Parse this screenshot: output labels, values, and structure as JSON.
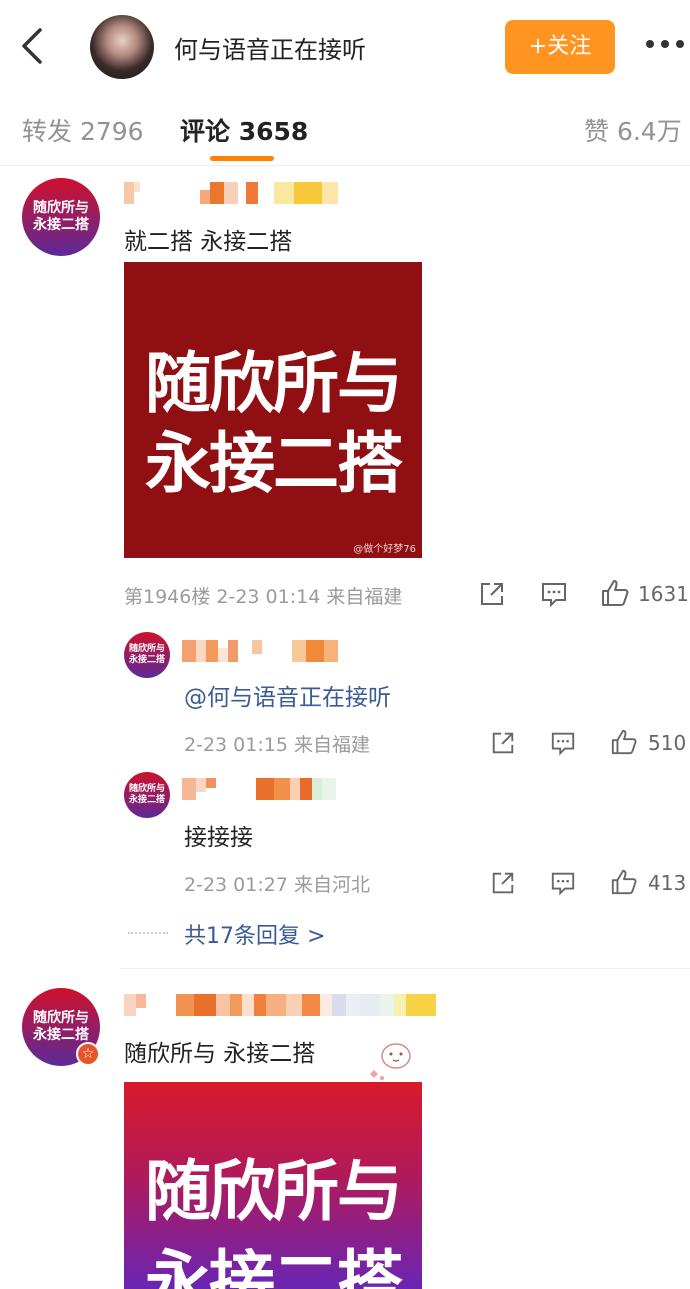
{
  "header": {
    "title": "何与语音正在接听",
    "follow_label": "+关注"
  },
  "tabs": {
    "repost": "转发 2796",
    "comment": "评论 3658",
    "like": "赞 6.4万"
  },
  "comments": [
    {
      "avatar_text_line1": "随欣所与",
      "avatar_text_line2": "永接二搭",
      "text": "就二搭 永接二搭",
      "image_line1": "随欣所与",
      "image_line2": "永接二搭",
      "image_watermark": "@做个好梦76",
      "meta": "第1946楼 2-23 01:14 来自福建",
      "likes": "1631",
      "replies": [
        {
          "avatar_text_line1": "随欣所与",
          "avatar_text_line2": "永接二搭",
          "text": "@何与语音正在接听",
          "meta": "2-23 01:15 来自福建",
          "likes": "510"
        },
        {
          "avatar_text_line1": "随欣所与",
          "avatar_text_line2": "永接二搭",
          "text": "接接接",
          "meta": "2-23 01:27 来自河北",
          "likes": "413"
        }
      ],
      "more_replies": "共17条回复 >"
    },
    {
      "avatar_text_line1": "随欣所与",
      "avatar_text_line2": "永接二搭",
      "text": "随欣所与 永接二搭",
      "image_line1": "随欣所与",
      "image_line2": "永接二搭"
    }
  ],
  "colors": {
    "accent": "#ff8200",
    "follow_button": "#ff9520",
    "link": "#3b5b93",
    "image1_bg": "#8f0f12"
  }
}
